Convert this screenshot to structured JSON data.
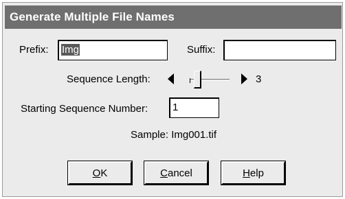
{
  "window": {
    "title": "Generate Multiple File Names"
  },
  "prefix": {
    "label": "Prefix:",
    "value": "Img"
  },
  "suffix": {
    "label": "Suffix:",
    "value": ""
  },
  "sequence_length": {
    "label": "Sequence Length:",
    "value": "3",
    "level": 0.0
  },
  "starting_number": {
    "label": "Starting Sequence Number:",
    "value": "1"
  },
  "sample": {
    "text": "Sample: Img001.tif"
  },
  "buttons": {
    "ok": {
      "mnemonic": "O",
      "rest": "K"
    },
    "cancel": {
      "mnemonic": "C",
      "rest": "ancel"
    },
    "help": {
      "mnemonic": "H",
      "rest": "elp"
    }
  },
  "icons": [
    "left-arrow-icon",
    "right-arrow-icon"
  ]
}
